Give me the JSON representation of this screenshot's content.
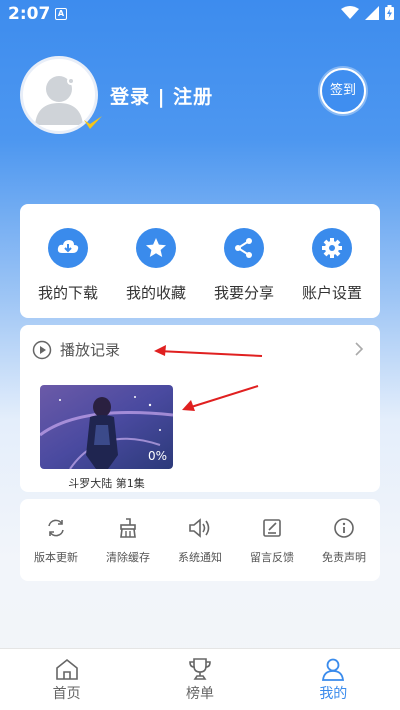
{
  "status_bar": {
    "time": "2:07",
    "notif_glyph": "A"
  },
  "profile": {
    "login_text": "登录 | 注册",
    "checkin_label": "签到"
  },
  "quick_actions": [
    {
      "label": "我的下载",
      "icon": "cloud-download-icon"
    },
    {
      "label": "我的收藏",
      "icon": "star-icon"
    },
    {
      "label": "我要分享",
      "icon": "share-icon"
    },
    {
      "label": "账户设置",
      "icon": "gear-icon"
    }
  ],
  "history": {
    "title": "播放记录",
    "items": [
      {
        "caption": "斗罗大陆 第1集",
        "progress": "0%"
      }
    ]
  },
  "tools": [
    {
      "label": "版本更新",
      "icon": "refresh-icon"
    },
    {
      "label": "清除缓存",
      "icon": "broom-icon"
    },
    {
      "label": "系统通知",
      "icon": "speaker-icon"
    },
    {
      "label": "留言反馈",
      "icon": "edit-icon"
    },
    {
      "label": "免责声明",
      "icon": "info-icon"
    }
  ],
  "bottom_nav": [
    {
      "label": "首页",
      "icon": "home-icon",
      "active": false
    },
    {
      "label": "榜单",
      "icon": "trophy-icon",
      "active": false
    },
    {
      "label": "我的",
      "icon": "user-icon",
      "active": true
    }
  ],
  "colors": {
    "accent": "#3a8bec",
    "annotation": "#e02020"
  }
}
